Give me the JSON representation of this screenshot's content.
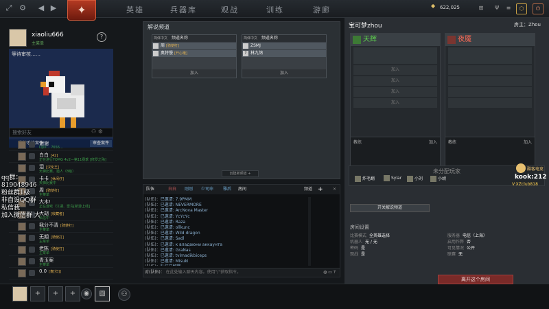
{
  "topbar": {
    "nav": [
      "英雄",
      "兵器库",
      "观战",
      "训练",
      "游廊"
    ],
    "gold": "622,025"
  },
  "profile": {
    "username": "xiaoliu666",
    "status": "主菜单",
    "help": "?"
  },
  "showcase": {
    "waiting": "等待审核……",
    "system_label": "监管系统案件",
    "review_button": "审查案件"
  },
  "search": {
    "placeholder": "搜索好友"
  },
  "friends": [
    {
      "name": "谢谢",
      "tag": "",
      "status": "DJDI… 7656…"
    },
    {
      "name": "白白",
      "tag": "[42]",
      "status": "正在进行FOMG 4v2—第11赛季 [修罗之殇]"
    },
    {
      "name": "泪",
      "tag": "[汉化王]",
      "status": "天梯比赛，猎人（8级）"
    },
    {
      "name": "卡卡",
      "tag": "[休闲仔]",
      "status": "天梯比赛中"
    },
    {
      "name": "周",
      "tag": "[骑使打]",
      "status": "主菜单"
    },
    {
      "name": "大木!",
      "tag": "",
      "status": "正在游戏（江湖、雷鸟[新游上线]"
    },
    {
      "name": "大胡",
      "tag": "[收藏者]",
      "status": "私信中"
    },
    {
      "name": "我分不清",
      "tag": "[骑使打]",
      "status": "主菜单"
    },
    {
      "name": "无期",
      "tag": "[骑使打]",
      "status": "主菜单"
    },
    {
      "name": "老陈",
      "tag": "[骑使打]",
      "status": "主菜单"
    },
    {
      "name": "青玉案",
      "tag": "",
      "status": "主菜单"
    },
    {
      "name": "0.0",
      "tag": "[麦[扫]]",
      "status": ""
    }
  ],
  "overlay_text": [
    "qq群：",
    "819048946",
    "粉丝群1级",
    "非自设QQ群",
    "私信我",
    "加入微信群 大"
  ],
  "channels": {
    "title": "解说频道",
    "col_label": "频道名称",
    "lang_label": "简体中文",
    "left": [
      {
        "name": "周",
        "tag": "[骑使打]"
      },
      {
        "name": "奥特慢",
        "tag": "[开心哦]"
      }
    ],
    "right": [
      {
        "name": "ZSMJ",
        "tag": ""
      },
      {
        "name": "林九鸽",
        "tag": ""
      }
    ],
    "join": "加入",
    "create": "创建新频道 +"
  },
  "chat": {
    "tabs": [
      "队伍",
      "白白",
      "刚刚",
      "少司命",
      "雅后",
      "房间"
    ],
    "header_right": "频道",
    "lines": [
      {
        "who": "(队伍)：",
        "txt": "已邀请: 7.9PMM"
      },
      {
        "who": "(队伍)：",
        "txt": "已邀请: NEVERMORE"
      },
      {
        "who": "(队伍)：",
        "txt": "已邀请: ArcNova Master"
      },
      {
        "who": "(队伍)：",
        "txt": "已邀请: YcYcYc"
      },
      {
        "who": "(队伍)：",
        "txt": "已邀请: Raza"
      },
      {
        "who": "(队伍)：",
        "txt": "已邀请: ollkunc"
      },
      {
        "who": "(队伍)：",
        "txt": "已邀请: Wild dragon"
      },
      {
        "who": "(队伍)：",
        "txt": "已邀请: Sadl"
      },
      {
        "who": "(队伍)：",
        "txt": "已邀请: к владаюни аккаунта"
      },
      {
        "who": "(队伍)：",
        "txt": "已邀请: GraNas"
      },
      {
        "who": "(队伍)：",
        "txt": "已邀请: tvlmadikbiceps"
      },
      {
        "who": "(队伍)：",
        "txt": "已邀请: Misuki"
      },
      {
        "who": "(队伍)：",
        "txt": "队伍已解散。"
      }
    ],
    "input_prefix": "对(队伍)：",
    "input_placeholder": "在此处输入聊天内容。使用\"/\"获取指令。"
  },
  "lobby": {
    "name": "宝可梦zhou",
    "host_label": "房主：",
    "host": "Zhou",
    "radiant": "天辉",
    "dire": "夜魇",
    "join": "加入",
    "coach": "教练",
    "unassigned": "未分配玩家",
    "unassigned_players": [
      "炸毛翻",
      "Sylar",
      "小刘",
      "小胡"
    ],
    "cast_button": "开关解说频道",
    "settings_title": "房间设置",
    "settings": [
      {
        "k": "比赛模式",
        "v": "全英雄选择"
      },
      {
        "k": "服务器",
        "v": "电信（上海）"
      },
      {
        "k": "机器人",
        "v": "无 / 无"
      },
      {
        "k": "启用作弊",
        "v": "否"
      },
      {
        "k": "密码",
        "v": "是"
      },
      {
        "k": "可见情况",
        "v": "公开"
      },
      {
        "k": "观战",
        "v": "是"
      },
      {
        "k": "联赛",
        "v": "无"
      }
    ],
    "leave": "离开这个房间"
  },
  "kook": {
    "line1": "酷客电竞",
    "line2": "kook:212",
    "line3": "V:XZclub818"
  },
  "colors": {
    "accent_green": "#4fb34a",
    "dire_red": "#e05a4a",
    "gold": "#e0c06a"
  }
}
